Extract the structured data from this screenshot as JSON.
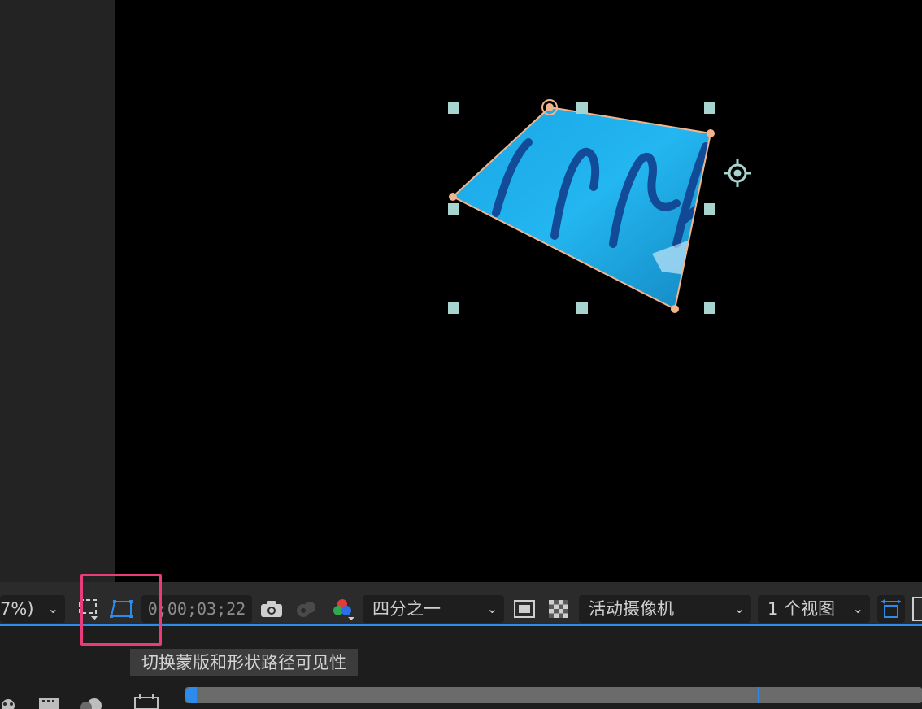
{
  "toolbar": {
    "magnification": "7%)",
    "timecode": "0;00;03;22",
    "resolution": "四分之一",
    "camera": "活动摄像机",
    "views": "1 个视图"
  },
  "tooltip": {
    "text": "切换蒙版和形状路径可见性"
  },
  "icons": {
    "mask_toggle": "mask-path-visibility-icon",
    "snapshot": "camera-icon",
    "show_snapshot": "show-snapshot-icon",
    "channel": "rgb-channel-icon"
  },
  "colors": {
    "accent": "#2d8ceb",
    "highlight": "#ea3c7a",
    "handle": "#a8d4cf",
    "mask_path": "#f2b48c"
  }
}
